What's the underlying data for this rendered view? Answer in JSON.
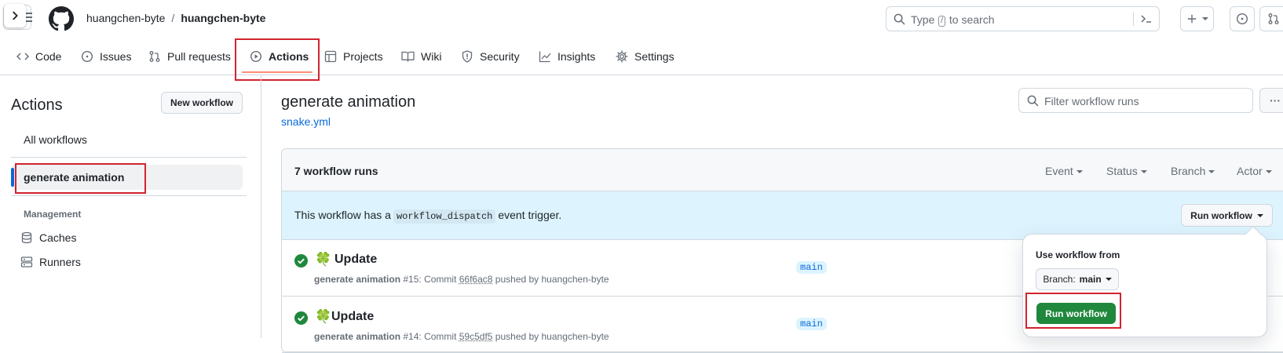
{
  "header": {
    "owner": "huangchen-byte",
    "separator": "/",
    "repo": "huangchen-byte",
    "search_prefix": "Type",
    "search_key": "/",
    "search_suffix": "to search"
  },
  "repo_nav": {
    "tabs": [
      {
        "label": "Code"
      },
      {
        "label": "Issues"
      },
      {
        "label": "Pull requests"
      },
      {
        "label": "Actions",
        "selected": true
      },
      {
        "label": "Projects"
      },
      {
        "label": "Wiki"
      },
      {
        "label": "Security"
      },
      {
        "label": "Insights"
      },
      {
        "label": "Settings"
      }
    ]
  },
  "sidebar": {
    "title": "Actions",
    "new_workflow": "New workflow",
    "all_workflows": "All workflows",
    "selected_workflow": "generate animation",
    "management_heading": "Management",
    "management_items": [
      {
        "label": "Caches",
        "icon": "database-icon"
      },
      {
        "label": "Runners",
        "icon": "server-icon"
      }
    ]
  },
  "workflow": {
    "title": "generate animation",
    "file": "snake.yml",
    "filter_placeholder": "Filter workflow runs",
    "run_count": "7 workflow runs",
    "filters": [
      "Event",
      "Status",
      "Branch",
      "Actor"
    ],
    "dispatch_before": "This workflow has a",
    "dispatch_code": "workflow_dispatch",
    "dispatch_after": "event trigger.",
    "run_button": "Run workflow",
    "runs": [
      {
        "emoji": "🍀",
        "title": "Update",
        "workflow": "generate animation",
        "number": "#15: Commit",
        "commit": "66f6ac8",
        "pushed_by": "pushed by huangchen-byte",
        "branch": "main",
        "status": "success"
      },
      {
        "emoji": "🍀",
        "title": "Update",
        "workflow": "generate animation",
        "number": "#14: Commit",
        "commit": "59c5df5",
        "pushed_by": "pushed by huangchen-byte",
        "branch": "main",
        "status": "success"
      }
    ]
  },
  "popover": {
    "use_from": "Use workflow from",
    "branch_label": "Branch:",
    "branch_value": "main",
    "run_button": "Run workflow"
  },
  "colors": {
    "accent": "#0969da",
    "highlight": "#d1242f",
    "success": "#1f883d",
    "tab_underline": "#fd8c73"
  }
}
